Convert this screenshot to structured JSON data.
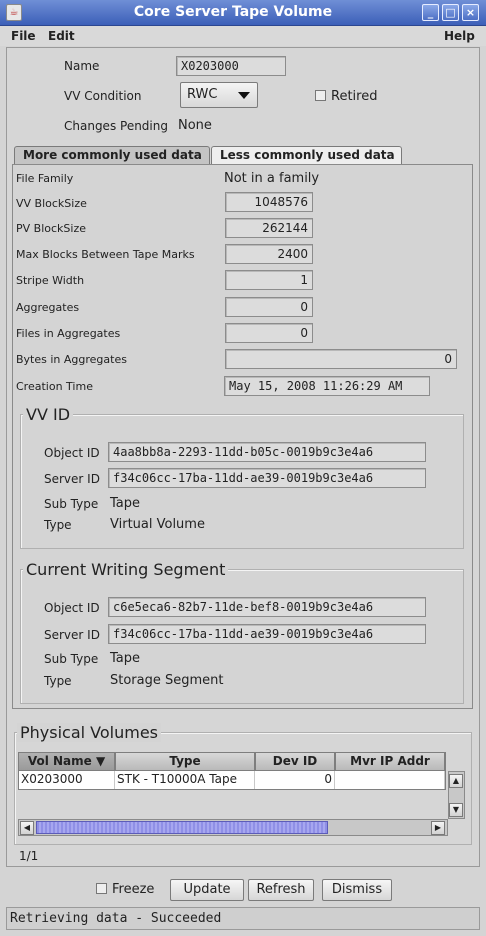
{
  "window": {
    "title": "Core Server Tape Volume",
    "icon": "java-cup-icon"
  },
  "window_controls": {
    "minimize": "_",
    "maximize": "□",
    "close": "×"
  },
  "menubar": {
    "file": "File",
    "edit": "Edit",
    "help": "Help"
  },
  "header": {
    "name_label": "Name",
    "name_value": "X0203000",
    "vv_condition_label": "VV Condition",
    "vv_condition_value": "RWC",
    "retired_label": "Retired",
    "retired_checked": false,
    "changes_pending_label": "Changes Pending",
    "changes_pending_value": "None"
  },
  "tabs": [
    {
      "label": "More commonly used data",
      "active": true
    },
    {
      "label": "Less commonly used data",
      "active": false
    }
  ],
  "details": {
    "file_family_label": "File Family",
    "file_family_value": "Not in a family",
    "vv_blocksize_label": "VV BlockSize",
    "vv_blocksize_value": "1048576",
    "pv_blocksize_label": "PV BlockSize",
    "pv_blocksize_value": "262144",
    "max_blocks_label": "Max Blocks Between Tape Marks",
    "max_blocks_value": "2400",
    "stripe_width_label": "Stripe Width",
    "stripe_width_value": "1",
    "aggregates_label": "Aggregates",
    "aggregates_value": "0",
    "files_in_aggregates_label": "Files in Aggregates",
    "files_in_aggregates_value": "0",
    "bytes_in_aggregates_label": "Bytes in Aggregates",
    "bytes_in_aggregates_value": "0",
    "creation_time_label": "Creation Time",
    "creation_time_value": "May 15, 2008 11:26:29 AM"
  },
  "vv_id": {
    "title": "VV ID",
    "object_id_label": "Object ID",
    "object_id_value": "4aa8bb8a-2293-11dd-b05c-0019b9c3e4a6",
    "server_id_label": "Server ID",
    "server_id_value": "f34c06cc-17ba-11dd-ae39-0019b9c3e4a6",
    "sub_type_label": "Sub Type",
    "sub_type_value": "Tape",
    "type_label": "Type",
    "type_value": "Virtual Volume"
  },
  "writing_segment": {
    "title": "Current Writing Segment",
    "object_id_label": "Object ID",
    "object_id_value": "c6e5eca6-82b7-11de-bef8-0019b9c3e4a6",
    "server_id_label": "Server ID",
    "server_id_value": "f34c06cc-17ba-11dd-ae39-0019b9c3e4a6",
    "sub_type_label": "Sub Type",
    "sub_type_value": "Tape",
    "type_label": "Type",
    "type_value": "Storage Segment"
  },
  "physical_volumes": {
    "title": "Physical Volumes",
    "columns": [
      "Vol Name ▼",
      "Type",
      "Dev ID",
      "Mvr IP Addr"
    ],
    "rows": [
      [
        "X0203000",
        "STK - T10000A Tape",
        "0",
        ""
      ]
    ],
    "count": "1/1"
  },
  "footer": {
    "freeze_label": "Freeze",
    "freeze_checked": false,
    "update_label": "Update",
    "refresh_label": "Refresh",
    "dismiss_label": "Dismiss"
  },
  "status": {
    "text": "Retrieving data - Succeeded"
  },
  "colors": {
    "titlebar": "#3c5fb8",
    "active_tab": "#c4c4c4",
    "table_selected_header": "#9a9a9a",
    "scroll_thumb": "#8f8fe6"
  }
}
